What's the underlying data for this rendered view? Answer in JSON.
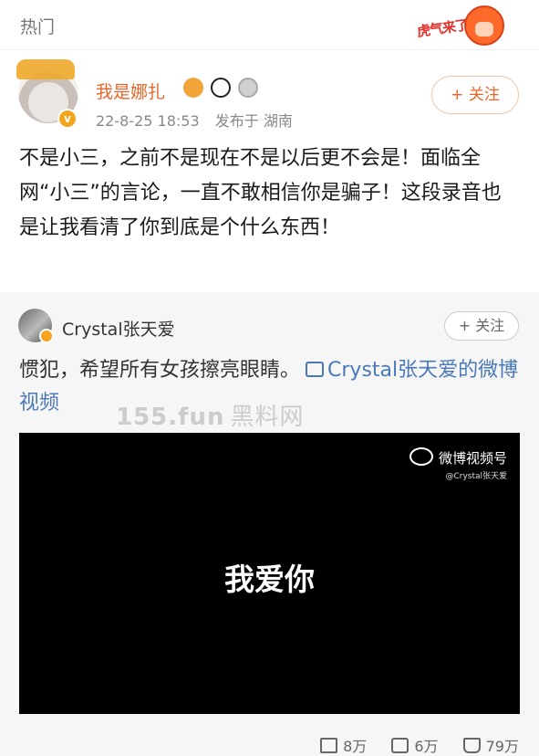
{
  "header": {
    "title": "热门",
    "logo_text": "虎气来了"
  },
  "post": {
    "username": "我是娜扎",
    "verify_mark": "v",
    "date": "22-8-25 18:53",
    "location": "发布于 湖南",
    "follow_label": "+ 关注",
    "text": "不是小三，之前不是现在不是以后更不会是！面临全网“小三”的言论，一直不敢相信你是骗子！这段录音也是让我看清了你到底是个什么东西！",
    "badges": [
      "crown-badge",
      "panda-badge",
      "medal-badge"
    ]
  },
  "repost": {
    "username": "Crystal张天爱",
    "follow_label": "+ 关注",
    "text": "惯犯，希望所有女孩擦亮眼睛。",
    "link_text": "Crystal张天爱的微博视频"
  },
  "watermark": {
    "domain": "155.fun",
    "text": "黑料网"
  },
  "video": {
    "brand": "微博视频号",
    "brand_sub": "@Crystal张天爱",
    "caption": "我爱你"
  },
  "actions": {
    "reposts": "8万",
    "comments": "6万",
    "likes": "79万"
  },
  "colors": {
    "accent": "#e8662a",
    "link": "#4a79b8"
  }
}
